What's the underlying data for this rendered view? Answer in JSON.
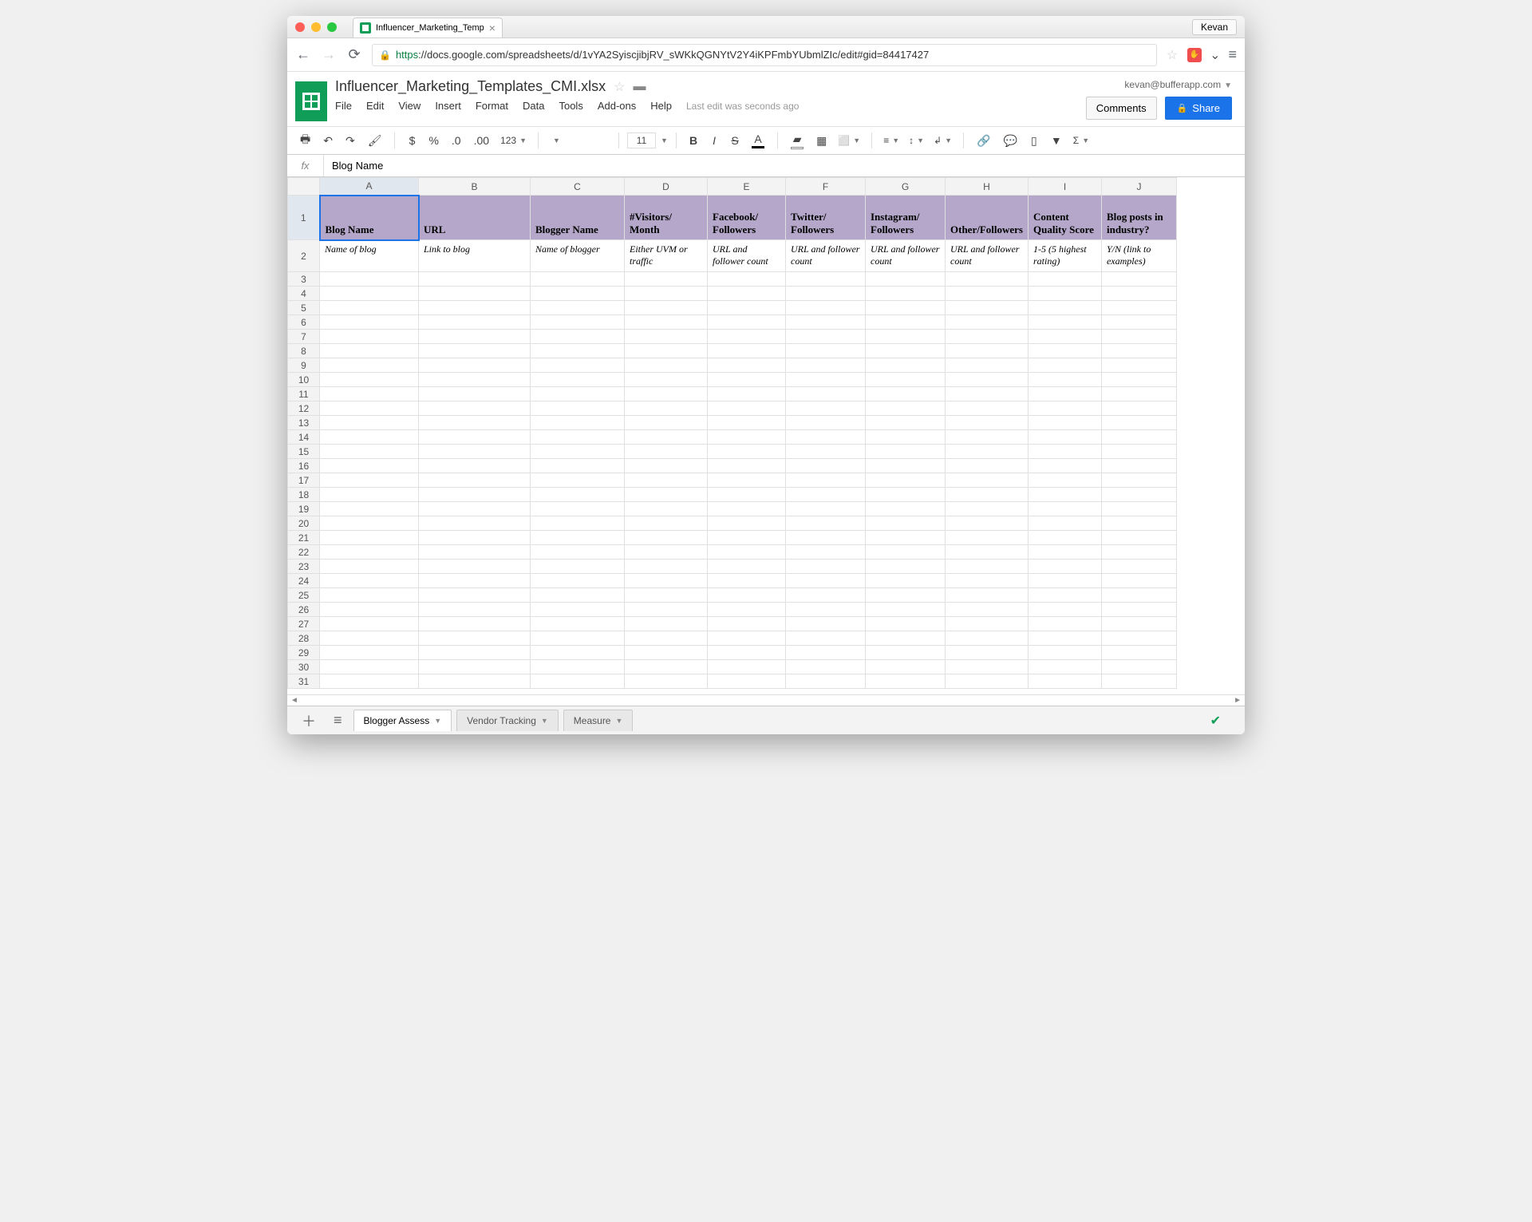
{
  "browser": {
    "profile_name": "Kevan",
    "tab_title": "Influencer_Marketing_Temp",
    "url_https": "https",
    "url_rest": "://docs.google.com/spreadsheets/d/1vYA2SyiscjibjRV_sWKkQGNYtV2Y4iKPFmbYUbmlZIc/edit#gid=84417427"
  },
  "doc": {
    "title": "Influencer_Marketing_Templates_CMI.xlsx",
    "user_email": "kevan@bufferapp.com",
    "last_edit": "Last edit was seconds ago",
    "comments_label": "Comments",
    "share_label": "Share"
  },
  "menu": [
    "File",
    "Edit",
    "View",
    "Insert",
    "Format",
    "Data",
    "Tools",
    "Add-ons",
    "Help"
  ],
  "toolbar": {
    "format_list": "123",
    "font_name": "",
    "font_size": "11"
  },
  "formula_bar": {
    "fx": "fx",
    "value": "Blog Name"
  },
  "columns": [
    "A",
    "B",
    "C",
    "D",
    "E",
    "F",
    "G",
    "H",
    "I",
    "J"
  ],
  "row_headers": [
    "1",
    "2",
    "3",
    "4",
    "5",
    "6",
    "7",
    "8",
    "9",
    "10",
    "11",
    "12",
    "13",
    "14",
    "15",
    "16",
    "17",
    "18",
    "19",
    "20",
    "21",
    "22",
    "23",
    "24",
    "25",
    "26",
    "27",
    "28",
    "29",
    "30",
    "31"
  ],
  "header_row": {
    "A": "Blog Name",
    "B": "URL",
    "C": "Blogger Name",
    "D": "#Visitors/\nMonth",
    "E": "Facebook/\nFollowers",
    "F": "Twitter/\nFollowers",
    "G": "Instagram/\nFollowers",
    "H": "Other/Followers",
    "I": "Content Quality Score",
    "J": "Blog posts in industry?"
  },
  "desc_row": {
    "A": "Name of blog",
    "B": "Link to blog",
    "C": "Name of blogger",
    "D": "Either UVM or traffic",
    "E": "URL and follower count",
    "F": "URL and follower count",
    "G": "URL and follower count",
    "H": "URL and follower count",
    "I": "1-5 (5 highest rating)",
    "J": "Y/N (link to examples)"
  },
  "sheet_tabs": [
    "Blogger Assess",
    "Vendor Tracking",
    "Measure"
  ],
  "active_tab": 0
}
